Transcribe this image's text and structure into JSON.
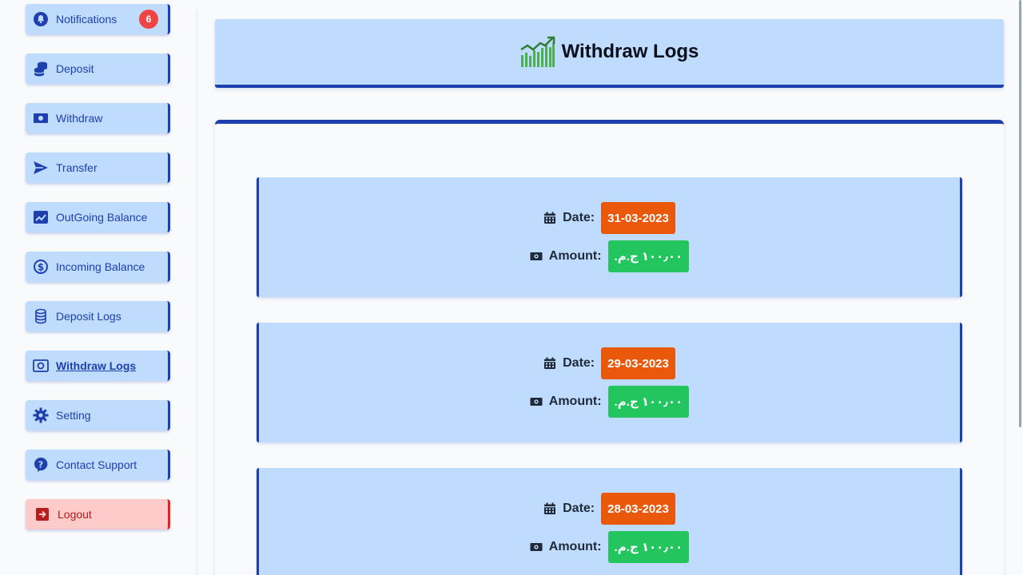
{
  "sidebar": {
    "items": [
      {
        "label": "Notifications",
        "icon": "bell-icon",
        "badge": "6"
      },
      {
        "label": "Deposit",
        "icon": "coins-icon"
      },
      {
        "label": "Withdraw",
        "icon": "banknote-icon"
      },
      {
        "label": "Transfer",
        "icon": "paper-plane-icon"
      },
      {
        "label": "OutGoing Balance",
        "icon": "chart-up-icon"
      },
      {
        "label": "Incoming Balance",
        "icon": "dollar-circle-icon"
      },
      {
        "label": "Deposit Logs",
        "icon": "database-icon"
      },
      {
        "label": "Withdraw Logs",
        "icon": "money-bill-icon",
        "active": true
      },
      {
        "label": "Setting",
        "icon": "gear-icon"
      },
      {
        "label": "Contact Support",
        "icon": "question-icon"
      },
      {
        "label": "Logout",
        "icon": "logout-icon"
      }
    ]
  },
  "header": {
    "title": "Withdraw Logs",
    "icon": "growth-chart-icon"
  },
  "logs": {
    "date_label": "Date:",
    "amount_label": "Amount:",
    "entries": [
      {
        "date": "31-03-2023",
        "amount": "١٠٠٫٠٠ ج.م."
      },
      {
        "date": "29-03-2023",
        "amount": "١٠٠٫٠٠ ج.م."
      },
      {
        "date": "28-03-2023",
        "amount": "١٠٠٫٠٠ ج.م."
      }
    ]
  },
  "colors": {
    "accent": "#1e40af",
    "card_bg": "#bfdbfe",
    "date_pill": "#ea580c",
    "amount_pill": "#22c55e",
    "badge": "#ef4444",
    "logout_bg": "#fecaca"
  }
}
